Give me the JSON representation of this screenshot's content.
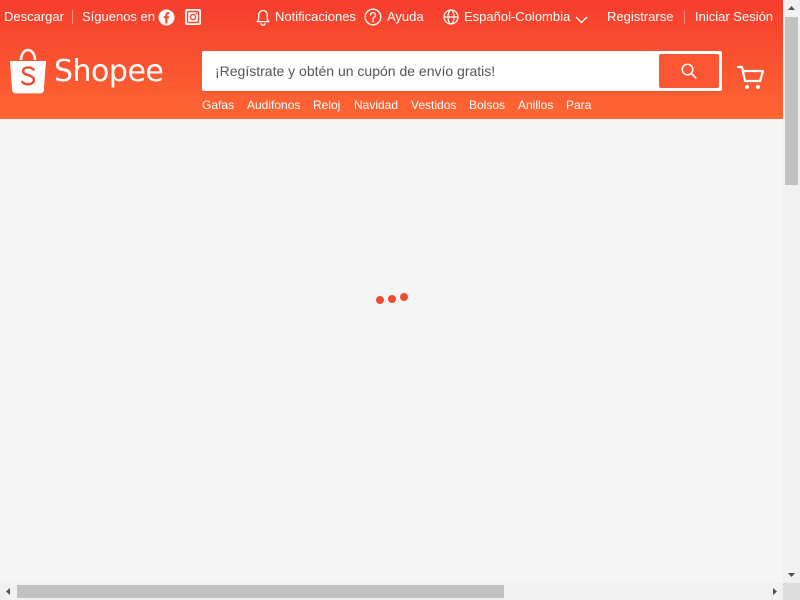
{
  "topbar": {
    "download_label": "Descargar",
    "follow_label": "Síguenos en",
    "notifications_label": "Notificaciones",
    "help_label": "Ayuda",
    "language_label": "Español-Colombia",
    "register_label": "Registrarse",
    "login_label": "Iniciar Sesión"
  },
  "logo": {
    "text": "Shopee"
  },
  "search": {
    "placeholder": "¡Regístrate y obtén un cupón de envío gratis!",
    "value": ""
  },
  "suggestions": [
    "Gafas",
    "Audifonos",
    "Reloj",
    "Navidad",
    "Vestidos",
    "Bolsos",
    "Anillos",
    "Para"
  ],
  "icons": {
    "facebook": "facebook-icon",
    "instagram": "instagram-icon",
    "bell": "bell-icon",
    "help": "help-circle-icon",
    "globe": "globe-icon",
    "chevron": "chevron-down-icon",
    "search": "search-icon",
    "cart": "cart-icon",
    "loader": "loading-dots-icon"
  },
  "colors": {
    "brand_start": "#f53d2d",
    "brand_end": "#ff6633",
    "search_button": "#fb5533",
    "loader_dot": "#ee4d2d",
    "page_background": "#f5f5f5"
  }
}
